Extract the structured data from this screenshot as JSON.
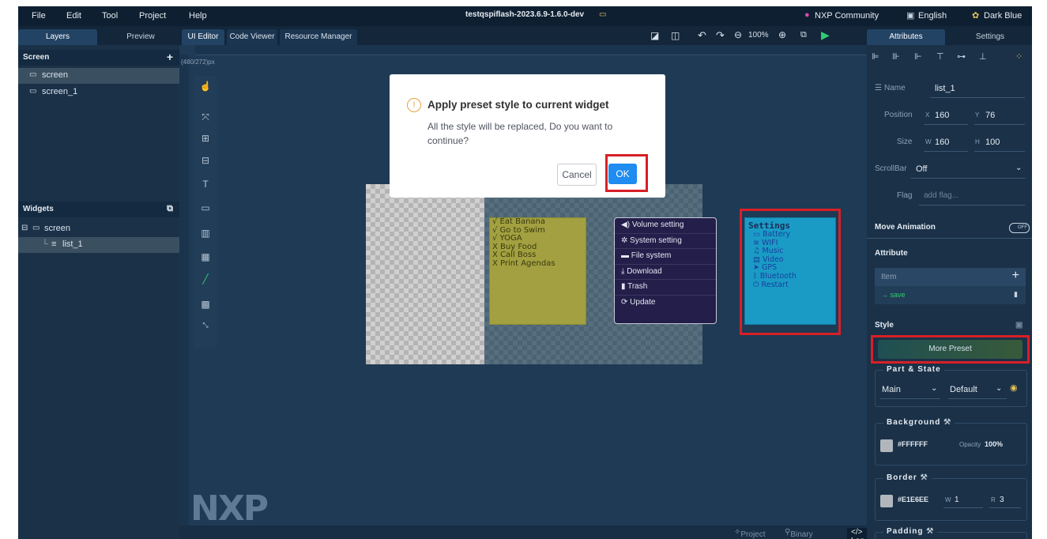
{
  "menubar": {
    "items": [
      "File",
      "Edit",
      "Tool",
      "Project",
      "Help"
    ],
    "title": "testqspiflash-2023.6.9-1.6.0-dev",
    "community": "NXP Community",
    "language": "English",
    "theme": "Dark Blue"
  },
  "left_tabs": [
    "Layers",
    "Preview"
  ],
  "editor_tabs": [
    "UI Editor",
    "Code Viewer",
    "Resource Manager"
  ],
  "right_tabs": [
    "Attributes",
    "Settings"
  ],
  "zoom": "100%",
  "screen_section": {
    "title": "Screen",
    "items": [
      "screen",
      "screen_1"
    ]
  },
  "widgets_section": {
    "title": "Widgets",
    "root": "screen",
    "child": "list_1"
  },
  "canvas": {
    "size_label": "(480/272)px",
    "note_lines": [
      "√ Eat Banana",
      "√ Go to Swim",
      "√ YOGA",
      "X Buy Food",
      "X Call Boss",
      "X Print Agendas"
    ],
    "menu_items": [
      "Volume setting",
      "System setting",
      "File system",
      "Download",
      "Trash",
      "Update"
    ],
    "settings_title": "Settings",
    "settings_items": [
      "Battery",
      "WIFI",
      "Music",
      "Video",
      "GPS",
      "Bluetooth",
      "Restart"
    ],
    "logo": "NXP"
  },
  "status": {
    "project": "Project",
    "binary_size": "Binary Size",
    "log": "</> Log"
  },
  "modal": {
    "title": "Apply preset style to current widget",
    "body": "All the style will be replaced, Do you want to continue?",
    "cancel": "Cancel",
    "ok": "OK"
  },
  "attributes": {
    "name_label": "Name",
    "name_value": "list_1",
    "position_label": "Position",
    "x_label": "X",
    "x_value": "160",
    "y_label": "Y",
    "y_value": "76",
    "size_label": "Size",
    "w_label": "W",
    "w_value": "160",
    "h_label": "H",
    "h_value": "100",
    "scrollbar_label": "ScrollBar",
    "scrollbar_value": "Off",
    "flag_label": "Flag",
    "flag_placeholder": "add flag...",
    "move_animation": "Move Animation",
    "toggle_text": "OFF",
    "attribute_title": "Attribute",
    "item_label": "Item",
    "save_label": "→ save",
    "style_title": "Style",
    "more_preset": "More Preset",
    "part_state": "Part & State",
    "part_value": "Main",
    "state_value": "Default",
    "background": "Background",
    "bg_color": "#FFFFFF",
    "opacity_label": "Opacity",
    "opacity_value": "100%",
    "border": "Border",
    "border_color": "#E1E6EE",
    "border_w_label": "W",
    "border_w": "1",
    "border_r_label": "R",
    "border_r": "3",
    "padding": "Padding"
  }
}
